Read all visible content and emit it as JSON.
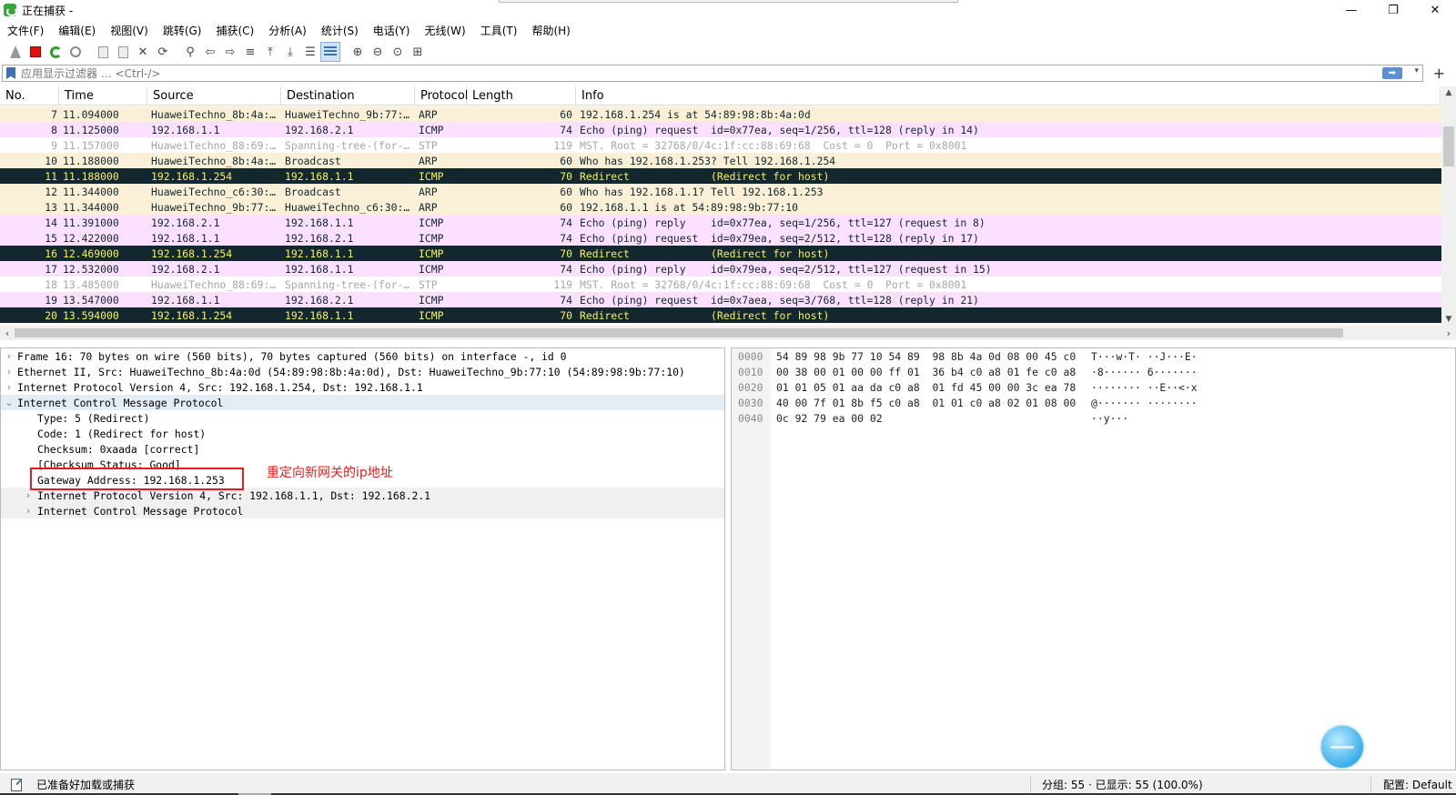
{
  "window": {
    "title": "正在捕获 -",
    "controls": [
      "—",
      "❐",
      "✕"
    ]
  },
  "menu": [
    "文件(F)",
    "编辑(E)",
    "视图(V)",
    "跳转(G)",
    "捕获(C)",
    "分析(A)",
    "统计(S)",
    "电话(Y)",
    "无线(W)",
    "工具(T)",
    "帮助(H)"
  ],
  "toolbar": {
    "icons": [
      "shark-fin-icon",
      "stop-icon",
      "restart-icon",
      "capture-options-icon",
      "open-file-icon",
      "save-file-icon",
      "close-file-icon",
      "reload-icon",
      "find-icon",
      "go-back-icon",
      "go-forward-icon",
      "go-to-packet-icon",
      "first-packet-icon",
      "last-packet-icon",
      "autoscroll-icon",
      "colorize-icon",
      "zoom-in-icon",
      "zoom-out-icon",
      "zoom-normal-icon",
      "resize-columns-icon"
    ]
  },
  "filter": {
    "placeholder": "应用显示过滤器 … <Ctrl-/>",
    "value": ""
  },
  "columns": [
    "No.",
    "Time",
    "Source",
    "Destination",
    "Protocol",
    "Length",
    "Info"
  ],
  "packets": [
    {
      "no": "7",
      "time": "11.094000",
      "src": "HuaweiTechno_8b:4a:…",
      "dst": "HuaweiTechno_9b:77:…",
      "proto": "ARP",
      "len": "60",
      "info": "192.168.1.254 is at 54:89:98:8b:4a:0d",
      "style": "arp"
    },
    {
      "no": "8",
      "time": "11.125000",
      "src": "192.168.1.1",
      "dst": "192.168.2.1",
      "proto": "ICMP",
      "len": "74",
      "info": "Echo (ping) request  id=0x77ea, seq=1/256, ttl=128 (reply in 14)",
      "style": "icmp"
    },
    {
      "no": "9",
      "time": "11.157000",
      "src": "HuaweiTechno_88:69:…",
      "dst": "Spanning-tree-(for-…",
      "proto": "STP",
      "len": "119",
      "info": "MST. Root = 32768/0/4c:1f:cc:88:69:68  Cost = 0  Port = 0x8001",
      "style": "stp"
    },
    {
      "no": "10",
      "time": "11.188000",
      "src": "HuaweiTechno_8b:4a:…",
      "dst": "Broadcast",
      "proto": "ARP",
      "len": "60",
      "info": "Who has 192.168.1.253? Tell 192.168.1.254",
      "style": "arp"
    },
    {
      "no": "11",
      "time": "11.188000",
      "src": "192.168.1.254",
      "dst": "192.168.1.1",
      "proto": "ICMP",
      "len": "70",
      "info": "Redirect             (Redirect for host)",
      "style": "err"
    },
    {
      "no": "12",
      "time": "11.344000",
      "src": "HuaweiTechno_c6:30:…",
      "dst": "Broadcast",
      "proto": "ARP",
      "len": "60",
      "info": "Who has 192.168.1.1? Tell 192.168.1.253",
      "style": "arp"
    },
    {
      "no": "13",
      "time": "11.344000",
      "src": "HuaweiTechno_9b:77:…",
      "dst": "HuaweiTechno_c6:30:…",
      "proto": "ARP",
      "len": "60",
      "info": "192.168.1.1 is at 54:89:98:9b:77:10",
      "style": "arp"
    },
    {
      "no": "14",
      "time": "11.391000",
      "src": "192.168.2.1",
      "dst": "192.168.1.1",
      "proto": "ICMP",
      "len": "74",
      "info": "Echo (ping) reply    id=0x77ea, seq=1/256, ttl=127 (request in 8)",
      "style": "icmp"
    },
    {
      "no": "15",
      "time": "12.422000",
      "src": "192.168.1.1",
      "dst": "192.168.2.1",
      "proto": "ICMP",
      "len": "74",
      "info": "Echo (ping) request  id=0x79ea, seq=2/512, ttl=128 (reply in 17)",
      "style": "icmp"
    },
    {
      "no": "16",
      "time": "12.469000",
      "src": "192.168.1.254",
      "dst": "192.168.1.1",
      "proto": "ICMP",
      "len": "70",
      "info": "Redirect             (Redirect for host)",
      "style": "sel"
    },
    {
      "no": "17",
      "time": "12.532000",
      "src": "192.168.2.1",
      "dst": "192.168.1.1",
      "proto": "ICMP",
      "len": "74",
      "info": "Echo (ping) reply    id=0x79ea, seq=2/512, ttl=127 (request in 15)",
      "style": "icmp"
    },
    {
      "no": "18",
      "time": "13.485000",
      "src": "HuaweiTechno_88:69:…",
      "dst": "Spanning-tree-(for-…",
      "proto": "STP",
      "len": "119",
      "info": "MST. Root = 32768/0/4c:1f:cc:88:69:68  Cost = 0  Port = 0x8001",
      "style": "stp"
    },
    {
      "no": "19",
      "time": "13.547000",
      "src": "192.168.1.1",
      "dst": "192.168.2.1",
      "proto": "ICMP",
      "len": "74",
      "info": "Echo (ping) request  id=0x7aea, seq=3/768, ttl=128 (reply in 21)",
      "style": "icmp"
    },
    {
      "no": "20",
      "time": "13.594000",
      "src": "192.168.1.254",
      "dst": "192.168.1.1",
      "proto": "ICMP",
      "len": "70",
      "info": "Redirect             (Redirect for host)",
      "style": "err"
    }
  ],
  "details": [
    {
      "text": "Frame 16: 70 bytes on wire (560 bits), 70 bytes captured (560 bits) on interface -, id 0",
      "arrow": "›",
      "level": 0,
      "style": ""
    },
    {
      "text": "Ethernet II, Src: HuaweiTechno_8b:4a:0d (54:89:98:8b:4a:0d), Dst: HuaweiTechno_9b:77:10 (54:89:98:9b:77:10)",
      "arrow": "›",
      "level": 0,
      "style": ""
    },
    {
      "text": "Internet Protocol Version 4, Src: 192.168.1.254, Dst: 192.168.1.1",
      "arrow": "›",
      "level": 0,
      "style": ""
    },
    {
      "text": "Internet Control Message Protocol",
      "arrow": "⌄",
      "level": 0,
      "style": "hl"
    },
    {
      "text": "Type: 5 (Redirect)",
      "arrow": "",
      "level": 1,
      "style": ""
    },
    {
      "text": "Code: 1 (Redirect for host)",
      "arrow": "",
      "level": 1,
      "style": ""
    },
    {
      "text": "Checksum: 0xaada [correct]",
      "arrow": "",
      "level": 1,
      "style": ""
    },
    {
      "text": "[Checksum Status: Good]",
      "arrow": "",
      "level": 1,
      "style": ""
    },
    {
      "text": "Gateway Address: 192.168.1.253",
      "arrow": "",
      "level": 1,
      "style": ""
    },
    {
      "text": "Internet Protocol Version 4, Src: 192.168.1.1, Dst: 192.168.2.1",
      "arrow": "›",
      "level": 1,
      "style": "alt"
    },
    {
      "text": "Internet Control Message Protocol",
      "arrow": "›",
      "level": 1,
      "style": "alt"
    }
  ],
  "annotation": "重定向新网关的ip地址",
  "bytes": [
    {
      "off": "0000",
      "hex": "54 89 98 9b 77 10 54 89  98 8b 4a 0d 08 00 45 c0",
      "ascii": "T···w·T· ··J···E·"
    },
    {
      "off": "0010",
      "hex": "00 38 00 01 00 00 ff 01  36 b4 c0 a8 01 fe c0 a8",
      "ascii": "·8······ 6·······"
    },
    {
      "off": "0020",
      "hex": "01 01 05 01 aa da c0 a8  01 fd 45 00 00 3c ea 78",
      "ascii": "········ ··E··<·x"
    },
    {
      "off": "0030",
      "hex": "40 00 7f 01 8b f5 c0 a8  01 01 c0 a8 02 01 08 00",
      "ascii": "@······· ········"
    },
    {
      "off": "0040",
      "hex": "0c 92 79 ea 00 02",
      "ascii": "··y···"
    }
  ],
  "status": {
    "ready": "已准备好加载或捕获",
    "counts": "分组: 55 · 已显示: 55 (100.0%)",
    "profile": "配置: Default"
  },
  "colors": {
    "arp_bg": "#faf0d7",
    "icmp_bg": "#fce0ff",
    "error_bg": "#12272e",
    "error_fg": "#f7f25f",
    "annotation": "#e02020"
  }
}
